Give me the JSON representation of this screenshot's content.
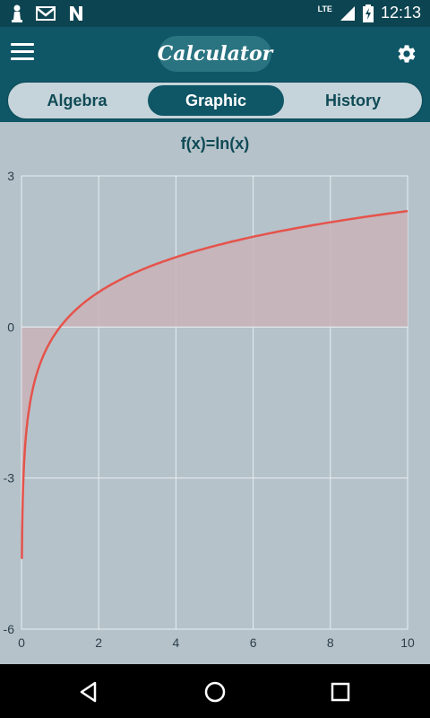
{
  "status_bar": {
    "time": "12:13",
    "network": "LTE",
    "icons": [
      "pawn-icon",
      "gmail-icon",
      "n-icon",
      "signal-icon",
      "battery-charging-icon"
    ]
  },
  "app_bar": {
    "title": "Calculator",
    "menu_icon": "hamburger-menu-icon",
    "settings_icon": "gear-icon"
  },
  "tabs": [
    {
      "label": "Algebra",
      "active": false
    },
    {
      "label": "Graphic",
      "active": true
    },
    {
      "label": "History",
      "active": false
    }
  ],
  "graph": {
    "function_label": "f(x)=ln(x)"
  },
  "chart_data": {
    "type": "area",
    "title": "f(x)=ln(x)",
    "function": "ln(x)",
    "xlim": [
      0,
      10
    ],
    "ylim": [
      -6,
      3
    ],
    "x_ticks": [
      "0",
      "2",
      "4",
      "6",
      "8",
      "10"
    ],
    "y_ticks": [
      "3",
      "0",
      "-3",
      "-6"
    ],
    "x_tick_values": [
      0,
      2,
      4,
      6,
      8,
      10
    ],
    "y_tick_values": [
      3,
      0,
      -3,
      -6
    ],
    "series": [
      {
        "x": [
          0.01,
          0.05,
          0.1,
          0.2,
          0.3,
          0.5,
          0.75,
          1,
          1.5,
          2,
          3,
          4,
          5,
          6,
          7,
          8,
          9,
          10
        ],
        "y": [
          -4.61,
          -3.0,
          -2.3,
          -1.61,
          -1.2,
          -0.69,
          -0.29,
          0,
          0.41,
          0.69,
          1.1,
          1.39,
          1.61,
          1.79,
          1.95,
          2.08,
          2.2,
          2.3
        ]
      }
    ],
    "line_color": "#e5534b",
    "fill_color": "#c9b3b9",
    "grid": true
  },
  "nav_bar": {
    "buttons": [
      "back-icon",
      "home-icon",
      "recents-icon"
    ]
  }
}
